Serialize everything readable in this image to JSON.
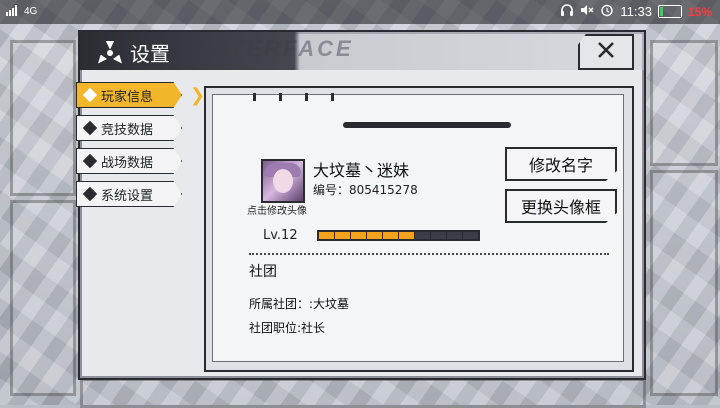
{
  "status_bar": {
    "signal": "4G",
    "time": "11:33",
    "battery_percent": "15%",
    "battery_level": 0.15,
    "icons": [
      "signal-icon",
      "headset-icon",
      "mute-icon",
      "alarm-icon",
      "battery-icon"
    ]
  },
  "window": {
    "title": "设置",
    "watermark": "INTERFACE",
    "close_icon": "close-icon"
  },
  "sidebar": {
    "items": [
      {
        "label": "玩家信息",
        "active": true
      },
      {
        "label": "竞技数据",
        "active": false
      },
      {
        "label": "战场数据",
        "active": false
      },
      {
        "label": "系统设置",
        "active": false
      }
    ]
  },
  "profile": {
    "name": "大坟墓丶迷妹",
    "id_text": "编号：805415278",
    "avatar_hint": "点击修改头像",
    "level": "Lv.12",
    "xp_filled_segments": 6,
    "xp_total_segments": 10
  },
  "actions": {
    "rename": "修改名字",
    "change_frame": "更换头像框"
  },
  "club": {
    "heading": "社团",
    "belongs": "所属社团：:大坟墓",
    "position": "社团职位:社长"
  },
  "colors": {
    "accent": "#f2b62b",
    "xp_fill": "#f2a31b",
    "xp_empty": "#2a2b30",
    "battery_low": "#ff3b3b"
  }
}
